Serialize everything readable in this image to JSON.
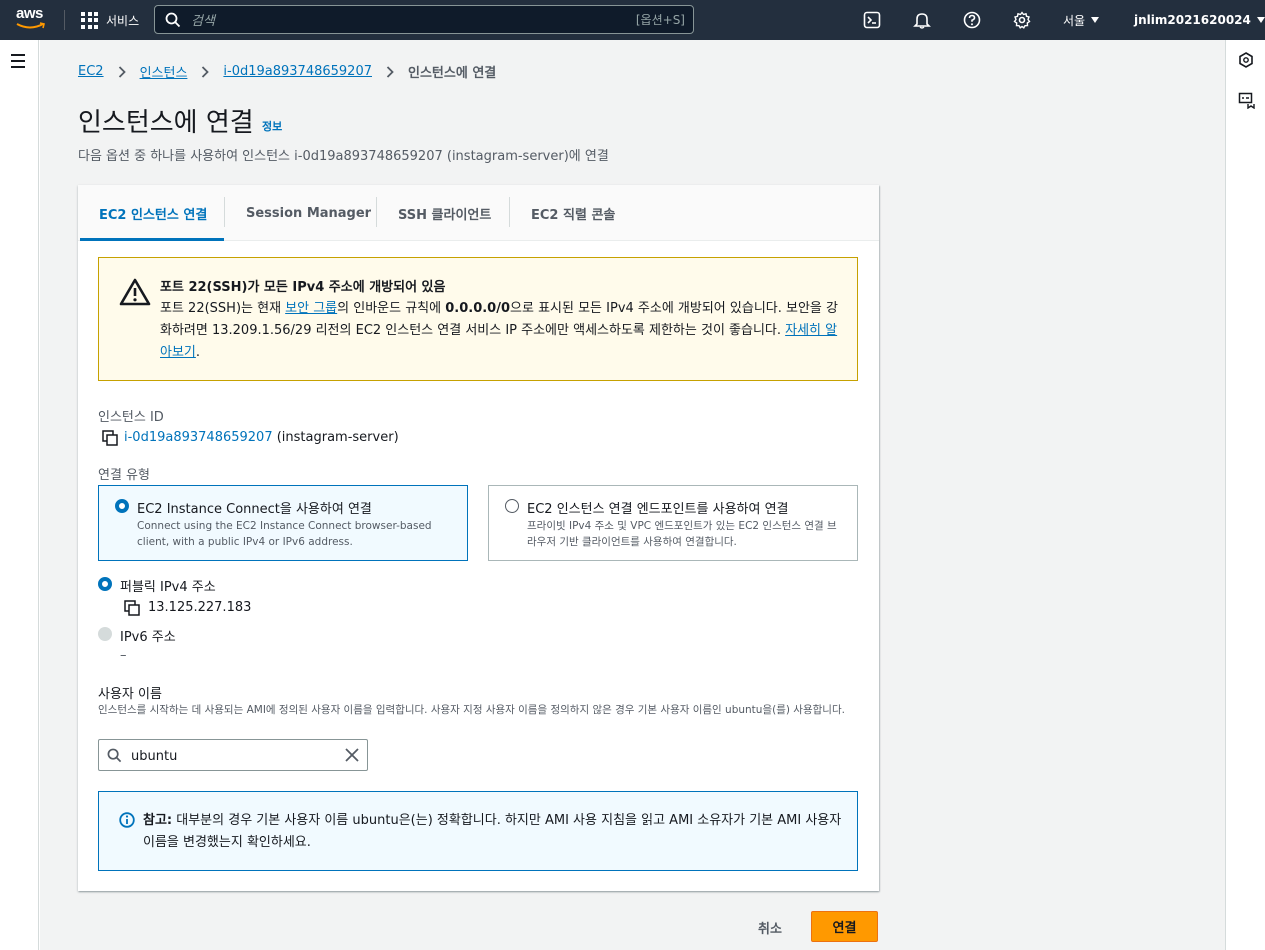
{
  "topnav": {
    "logo": "aws",
    "services_label": "서비스",
    "search_placeholder": "검색",
    "search_hint": "[옵션+S]",
    "region": "서울",
    "account": "jnlim2021620024",
    "icons": [
      "cloudshell-icon",
      "bell-icon",
      "help-icon",
      "gear-icon"
    ]
  },
  "breadcrumb": {
    "items": [
      "EC2",
      "인스턴스",
      "i-0d19a893748659207"
    ],
    "current": "인스턴스에 연결"
  },
  "page": {
    "title": "인스턴스에 연결",
    "info_link": "정보",
    "description": "다음 옵션 중 하나를 사용하여 인스턴스 i-0d19a893748659207 (instagram-server)에 연결"
  },
  "tabs": [
    {
      "label": "EC2 인스턴스 연결",
      "active": true
    },
    {
      "label": "Session Manager",
      "active": false
    },
    {
      "label": "SSH 클라이언트",
      "active": false
    },
    {
      "label": "EC2 직렬 콘솔",
      "active": false
    }
  ],
  "warning": {
    "title": "포트 22(SSH)가 모든 IPv4 주소에 개방되어 있음",
    "text_1": "포트 22(SSH)는 현재 ",
    "link_security_group": "보안 그룹",
    "text_2": "의 인바운드 규칙에 ",
    "cidr": "0.0.0.0/0",
    "text_3": "으로 표시된 모든 IPv4 주소에 개방되어 있습니다. 보안을 강화하려면 13.209.1.56/29 리전의 EC2 인스턴스 연결 서비스 IP 주소에만 액세스하도록 제한하는 것이 좋습니다. ",
    "link_learn_more": "자세히 알아보기",
    "text_4": "."
  },
  "instance": {
    "label": "인스턴스 ID",
    "id": "i-0d19a893748659207",
    "name": "(instagram-server)"
  },
  "connection_type": {
    "label": "연결 유형",
    "options": [
      {
        "title": "EC2 Instance Connect을 사용하여 연결",
        "desc": "Connect using the EC2 Instance Connect browser-based client, with a public IPv4 or IPv6 address.",
        "selected": true
      },
      {
        "title": "EC2 인스턴스 연결 엔드포인트를 사용하여 연결",
        "desc": "프라이빗 IPv4 주소 및 VPC 엔드포인트가 있는 EC2 인스턴스 연결 브라우저 기반 클라이언트를 사용하여 연결합니다.",
        "selected": false
      }
    ]
  },
  "address": {
    "public_ipv4_label": "퍼블릭 IPv4 주소",
    "public_ipv4_value": "13.125.227.183",
    "ipv6_label": "IPv6 주소",
    "ipv6_value": "–"
  },
  "username": {
    "label": "사용자 이름",
    "description": "인스턴스를 시작하는 데 사용되는 AMI에 정의된 사용자 이름을 입력합니다. 사용자 지정 사용자 이름을 정의하지 않은 경우 기본 사용자 이름인 ubuntu을(를) 사용합니다.",
    "value": "ubuntu"
  },
  "note": {
    "prefix": "참고:",
    "text": " 대부분의 경우 기본 사용자 이름 ubuntu은(는) 정확합니다. 하지만 AMI 사용 지침을 읽고 AMI 소유자가 기본 AMI 사용자 이름을 변경했는지 확인하세요."
  },
  "actions": {
    "cancel": "취소",
    "connect": "연결"
  },
  "colors": {
    "accent": "#0073bb",
    "primary_button": "#ff9900",
    "warning_border": "#c6a100",
    "topnav": "#232f3e"
  }
}
